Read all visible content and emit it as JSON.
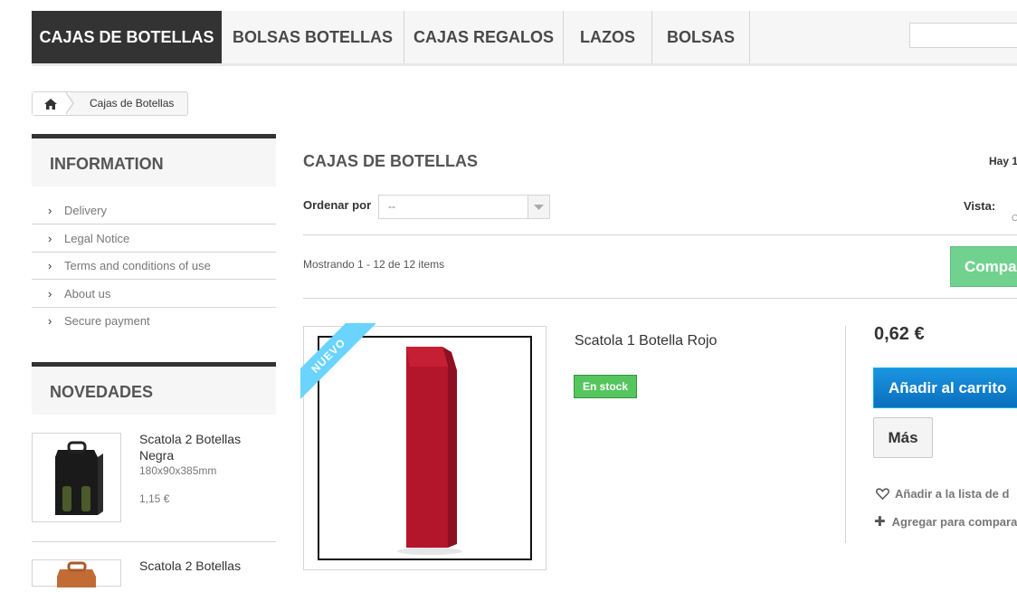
{
  "nav": {
    "items": [
      "CAJAS DE BOTELLAS",
      "BOLSAS BOTELLAS",
      "CAJAS REGALOS",
      "LAZOS",
      "BOLSAS"
    ]
  },
  "breadcrumb": {
    "current": "Cajas de Botellas"
  },
  "sidebar": {
    "info_title": "INFORMATION",
    "info_links": [
      "Delivery",
      "Legal Notice",
      "Terms and conditions of use",
      "About us",
      "Secure payment"
    ],
    "novedades_title": "NOVEDADES",
    "novedades": [
      {
        "name_line1": "Scatola 2 Botellas",
        "name_line2": "Negra",
        "desc": "180x90x385mm",
        "price": "1,15 €"
      },
      {
        "name_line1": "Scatola 2 Botellas"
      }
    ]
  },
  "main": {
    "title": "CAJAS DE BOTELLAS",
    "count_text": "Hay 1",
    "sort_label": "Ordenar por",
    "sort_value": "--",
    "view_label": "Vista:",
    "view_sub": "C",
    "showing": "Mostrando 1 - 12 de 12 items",
    "compare_label": "Compa"
  },
  "product": {
    "badge": "NUEVO",
    "name": "Scatola 1 Botella Rojo",
    "stock": "En stock",
    "price": "0,62 €",
    "add_to_cart": "Añadir al carrito",
    "more": "Más",
    "wishlist": "Añadir a la lista de d",
    "compare": "Agregar para compara"
  },
  "colors": {
    "nav_active": "#333333",
    "cart_button": "#0a6fbe",
    "stock_badge": "#55c65e",
    "compare_button": "#71d290",
    "ribbon": "#6ad4ff",
    "box_red": "#b3152b"
  }
}
